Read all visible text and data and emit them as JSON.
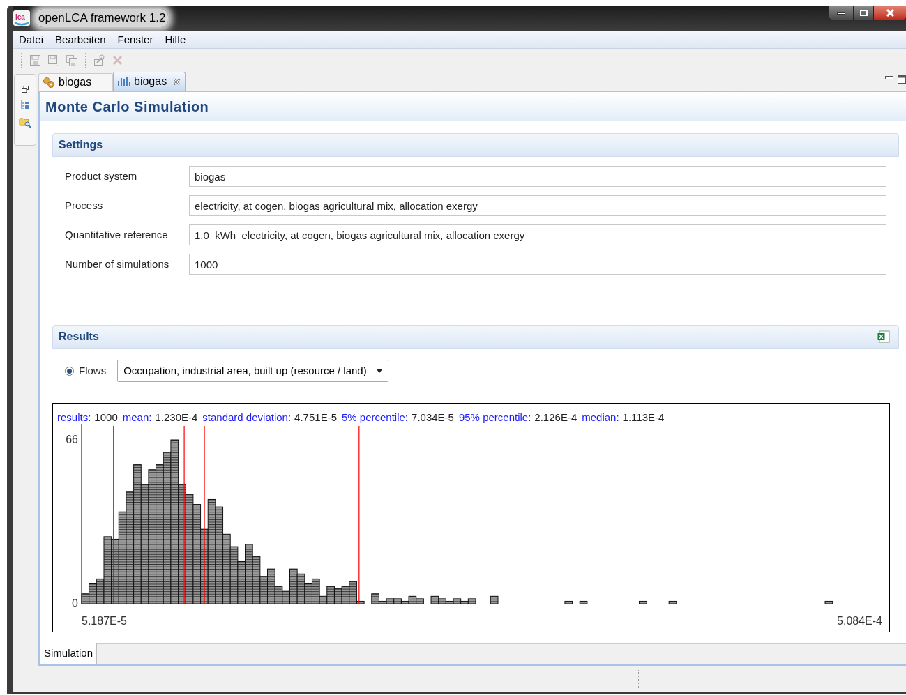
{
  "window": {
    "logo": "lca",
    "title": "openLCA framework 1.2"
  },
  "menu": [
    "Datei",
    "Bearbeiten",
    "Fenster",
    "Hilfe"
  ],
  "toolbar": [
    {
      "kind": "save",
      "disabled": true
    },
    {
      "kind": "saveas",
      "disabled": true
    },
    {
      "kind": "saveall",
      "disabled": true
    },
    {
      "kind": "edit",
      "disabled": true
    },
    {
      "kind": "delete",
      "disabled": true
    }
  ],
  "editor_tabs": [
    {
      "label": "biogas",
      "kind": "system",
      "selected": false
    },
    {
      "label": "biogas",
      "kind": "analysis",
      "selected": true
    }
  ],
  "form_title": "Monte Carlo Simulation",
  "settings": {
    "title": "Settings",
    "fields": [
      {
        "label": "Product system",
        "value": "biogas"
      },
      {
        "label": "Process",
        "value": "electricity, at cogen, biogas agricultural mix, allocation exergy"
      },
      {
        "label": "Quantitative reference",
        "value": "1.0  kWh  electricity, at cogen, biogas agricultural mix, allocation exergy"
      },
      {
        "label": "Number of simulations",
        "value": "1000"
      }
    ]
  },
  "results": {
    "title": "Results",
    "option": {
      "label": "Flows",
      "selected": true
    },
    "flow": "Occupation, industrial area, built up (resource / land)",
    "stats": [
      {
        "label": "results:",
        "value": "1000"
      },
      {
        "label": "mean:",
        "value": "1.230E-4",
        "marked": true
      },
      {
        "label": "standard deviation:",
        "value": "4.751E-5"
      },
      {
        "label": "5% percentile:",
        "value": "7.034E-5",
        "marked": true
      },
      {
        "label": "95% percentile:",
        "value": "2.126E-4",
        "marked": true
      },
      {
        "label": "median:",
        "value": "1.113E-4",
        "marked": true
      }
    ],
    "chart_data": {
      "type": "bar",
      "values": [
        4,
        8,
        10,
        27,
        26,
        37,
        45,
        56,
        48,
        54,
        56,
        61,
        66,
        48,
        44,
        40,
        30,
        42,
        39,
        28,
        23,
        17,
        24,
        19,
        11,
        14,
        7,
        5,
        14,
        12,
        8,
        10,
        3,
        7,
        6,
        7,
        9,
        1,
        0,
        4,
        1,
        2,
        2,
        1,
        3,
        2,
        0,
        3,
        2,
        1,
        2,
        1,
        2,
        0,
        0,
        3,
        0,
        0,
        0,
        0,
        0,
        0,
        0,
        0,
        0,
        1,
        0,
        1,
        0,
        0,
        0,
        0,
        0,
        0,
        0,
        1,
        0,
        0,
        0,
        1,
        0,
        0,
        0,
        0,
        0,
        0,
        0,
        0,
        0,
        0,
        0,
        0,
        0,
        0,
        0,
        0,
        0,
        0,
        0,
        0,
        1,
        0,
        0,
        0,
        0,
        0
      ],
      "ylim": [
        0,
        66
      ],
      "yticks": [
        0,
        66
      ],
      "grid": true
    },
    "axis_range_labels": [
      "5.187E-5",
      "5.084E-4"
    ]
  },
  "page_tabs": [
    {
      "label": "Simulation",
      "selected": true
    }
  ]
}
